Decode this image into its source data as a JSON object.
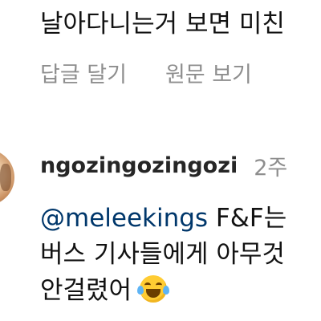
{
  "previous_comment": {
    "text_tail": "날아다니는거 보면 미친",
    "reply_label": "답글 달기",
    "view_original_label": "원문 보기"
  },
  "comment": {
    "username": "ngozingozingozi",
    "time": "2주",
    "mention": "@meleekings",
    "line1_rest": " F&F는",
    "line2": "버스 기사들에게 아무것",
    "line3": "안걸렸어",
    "emoji_icon": "face-with-tears-of-joy-icon"
  }
}
